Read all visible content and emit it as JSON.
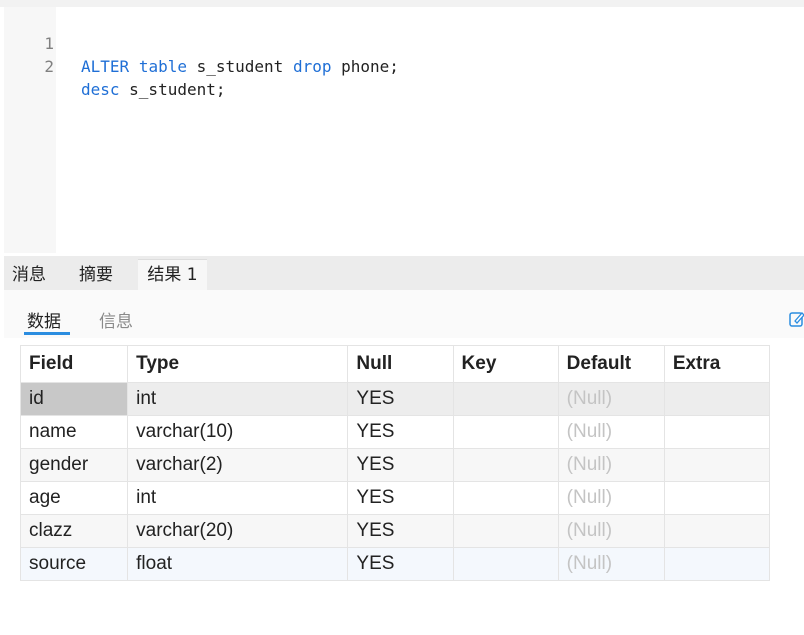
{
  "editor": {
    "lines": [
      {
        "num": "1",
        "kw1": "ALTER",
        "t1": " ",
        "kw2": "table",
        "t2": " s_student ",
        "kw3": "drop",
        "t3": " phone;"
      },
      {
        "num": "2",
        "kw1": "desc",
        "t1": " s_student;"
      }
    ]
  },
  "result_tabs": [
    "消息",
    "摘要",
    "结果 1"
  ],
  "sub_tabs": [
    "数据",
    "信息"
  ],
  "table": {
    "headers": [
      "Field",
      "Type",
      "Null",
      "Key",
      "Default",
      "Extra"
    ],
    "rows": [
      [
        "id",
        "int",
        "YES",
        "",
        "(Null)",
        ""
      ],
      [
        "name",
        "varchar(10)",
        "YES",
        "",
        "(Null)",
        ""
      ],
      [
        "gender",
        "varchar(2)",
        "YES",
        "",
        "(Null)",
        ""
      ],
      [
        "age",
        "int",
        "YES",
        "",
        "(Null)",
        ""
      ],
      [
        "clazz",
        "varchar(20)",
        "YES",
        "",
        "(Null)",
        ""
      ],
      [
        "source",
        "float",
        "YES",
        "",
        "(Null)",
        ""
      ]
    ]
  }
}
